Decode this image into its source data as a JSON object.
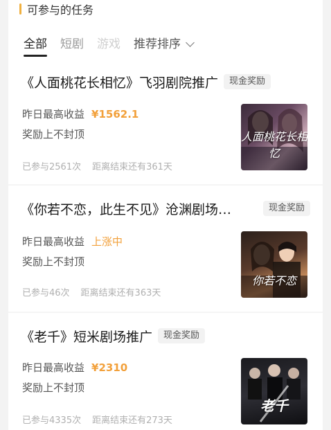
{
  "section": {
    "title": "可参与的任务"
  },
  "tabs": [
    {
      "label": "全部",
      "state": "active"
    },
    {
      "label": "短剧",
      "state": "normal"
    },
    {
      "label": "游戏",
      "state": "disabled"
    }
  ],
  "sort": {
    "label": "推荐排序",
    "icon": "chevron-down-icon"
  },
  "tasks": [
    {
      "title": "《人面桃花长相忆》飞羽剧院推广",
      "badge": "现金奖励",
      "earn_label": "昨日最高收益",
      "earn_value": "¥1562.1",
      "reward_note": "奖励上不封顶",
      "joined": "已参与2561次",
      "deadline": "距离结束还有361天",
      "poster_text": "人面桃花长相忆"
    },
    {
      "title": "《你若不恋，此生不见》沧渊剧场…",
      "badge": "现金奖励",
      "earn_label": "昨日最高收益",
      "earn_value": "上涨中",
      "reward_note": "奖励上不封顶",
      "joined": "已参与46次",
      "deadline": "距离结束还有363天",
      "poster_text": "你若不恋"
    },
    {
      "title": "《老千》短米剧场推广",
      "badge": "现金奖励",
      "earn_label": "昨日最高收益",
      "earn_value": "¥2310",
      "reward_note": "奖励上不封顶",
      "joined": "已参与4335次",
      "deadline": "距离结束还有273天",
      "poster_text": "老千"
    }
  ],
  "colors": {
    "accent": "#f2a03a",
    "section_bar": "#f0b040"
  }
}
